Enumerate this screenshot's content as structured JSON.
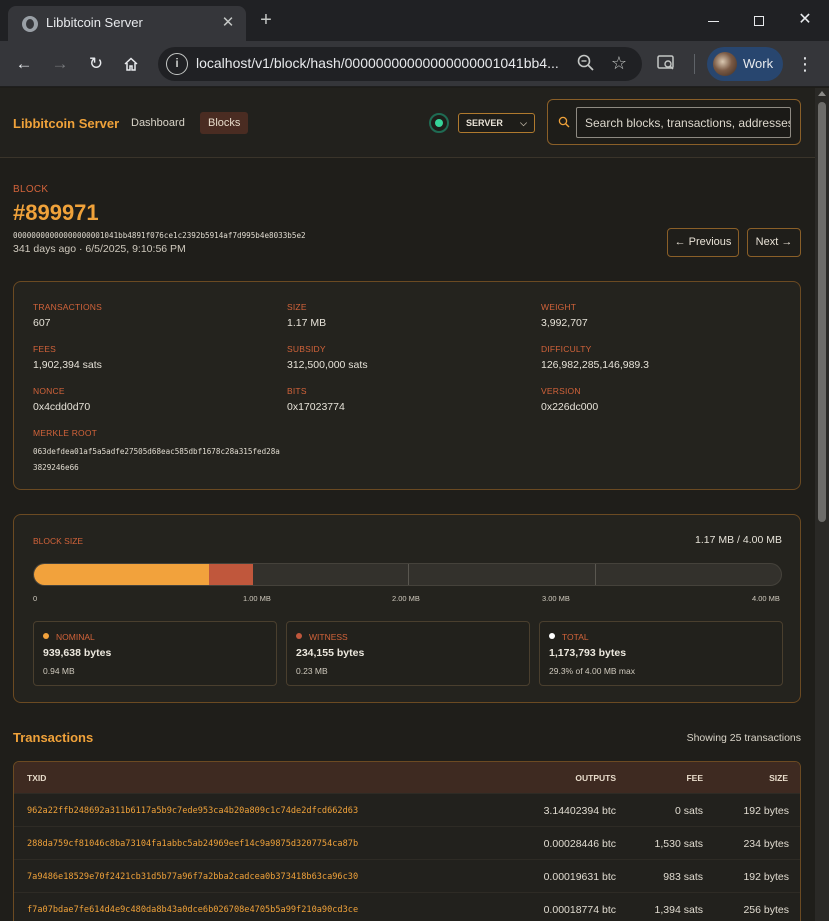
{
  "browser": {
    "tab_title": "Libbitcoin Server",
    "url": "localhost/v1/block/hash/00000000000000000001041bb4...",
    "profile_label": "Work"
  },
  "header": {
    "brand": "Libbitcoin Server",
    "nav": [
      {
        "label": "Dashboard",
        "active": false
      },
      {
        "label": "Blocks",
        "active": true
      }
    ],
    "server_select": "SERVER",
    "search_placeholder": "Search blocks, transactions, addresses"
  },
  "block": {
    "label": "BLOCK",
    "number": "#899971",
    "hash": "00000000000000000001041bb4891f076ce1c2392b5914af7d995b4e8033b5e2",
    "time": "341 days ago · 6/5/2025, 9:10:56 PM",
    "prev_label": "← Previous",
    "next_label": "Next →"
  },
  "stats": {
    "transactions": {
      "label": "TRANSACTIONS",
      "value": "607"
    },
    "size": {
      "label": "SIZE",
      "value": "1.17 MB"
    },
    "weight": {
      "label": "WEIGHT",
      "value": "3,992,707"
    },
    "fees": {
      "label": "FEES",
      "value": "1,902,394 sats"
    },
    "subsidy": {
      "label": "SUBSIDY",
      "value": "312,500,000 sats"
    },
    "difficulty": {
      "label": "DIFFICULTY",
      "value": "126,982,285,146,989.3"
    },
    "nonce": {
      "label": "NONCE",
      "value": "0x4cdd0d70"
    },
    "bits": {
      "label": "BITS",
      "value": "0x17023774"
    },
    "version": {
      "label": "VERSION",
      "value": "0x226dc000"
    },
    "merkle": {
      "label": "MERKLE ROOT",
      "value": "063defdea01af5a5adfe27505d68eac585dbf1678c28a315fed28a3829246e66"
    }
  },
  "block_size": {
    "title": "BLOCK SIZE",
    "total_text": "1.17 MB / 4.00 MB",
    "nominal_fraction": 0.2349,
    "witness_fraction": 0.0586,
    "scale": [
      "0",
      "1.00 MB",
      "2.00 MB",
      "3.00 MB",
      "4.00 MB"
    ],
    "legend": [
      {
        "label": "NOMINAL",
        "value": "939,638 bytes",
        "sub": "0.94 MB",
        "color": "#f2a23c"
      },
      {
        "label": "WITNESS",
        "value": "234,155 bytes",
        "sub": "0.23 MB",
        "color": "#c0573c"
      },
      {
        "label": "TOTAL",
        "value": "1,173,793 bytes",
        "sub": "29.3% of 4.00 MB max",
        "color": "#ffffff"
      }
    ]
  },
  "transactions": {
    "heading": "Transactions",
    "count_text": "Showing 25 transactions",
    "columns": {
      "txid": "TXID",
      "outputs": "OUTPUTS",
      "fee": "FEE",
      "size": "SIZE"
    },
    "rows": [
      {
        "txid": "962a22ffb248692a311b6117a5b9c7ede953ca4b20a809c1c74de2dfcd662d63",
        "outputs": "3.14402394 btc",
        "fee": "0 sats",
        "size": "192 bytes"
      },
      {
        "txid": "288da759cf81046c8ba73104fa1abbc5ab24969eef14c9a9875d3207754ca87b",
        "outputs": "0.00028446 btc",
        "fee": "1,530 sats",
        "size": "234 bytes"
      },
      {
        "txid": "7a9486e18529e70f2421cb31d5b77a96f7a2bba2cadcea0b373418b63ca96c30",
        "outputs": "0.00019631 btc",
        "fee": "983 sats",
        "size": "192 bytes"
      },
      {
        "txid": "f7a07bdae7fe614d4e9c480da8b43a0dce6b026708e4705b5a99f210a90cd3ce",
        "outputs": "0.00018774 btc",
        "fee": "1,394 sats",
        "size": "256 bytes"
      }
    ]
  }
}
